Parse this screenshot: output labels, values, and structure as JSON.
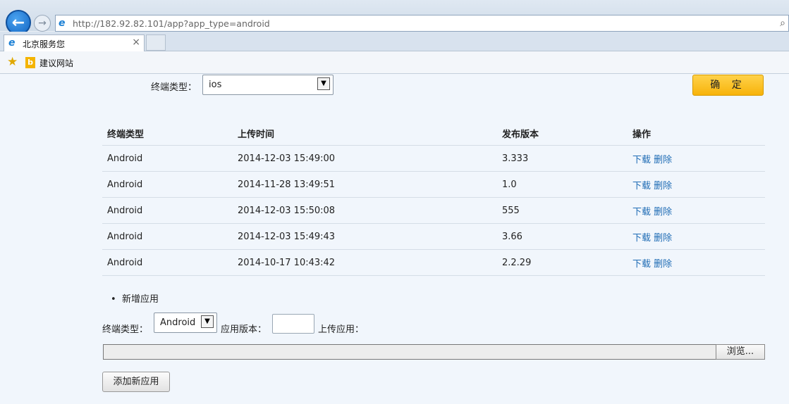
{
  "browser": {
    "url": "http://182.92.82.101/app?app_type=android",
    "tab_title": "北京服务您",
    "favorite_link": "建议网站",
    "tab_close": "×"
  },
  "filter": {
    "label": "终端类型：",
    "selected": "ios",
    "confirm_label": "确 定"
  },
  "table": {
    "headers": [
      "终端类型",
      "上传时间",
      "发布版本",
      "操作"
    ],
    "rows": [
      {
        "type": "Android",
        "time": "2014-12-03 15:49:00",
        "version": "3.333",
        "download": "下载",
        "delete": "删除"
      },
      {
        "type": "Android",
        "time": "2014-11-28 13:49:51",
        "version": "1.0",
        "download": "下载",
        "delete": "删除"
      },
      {
        "type": "Android",
        "time": "2014-12-03 15:50:08",
        "version": "555",
        "download": "下载",
        "delete": "删除"
      },
      {
        "type": "Android",
        "time": "2014-12-03 15:49:43",
        "version": "3.66",
        "download": "下载",
        "delete": "删除"
      },
      {
        "type": "Android",
        "time": "2014-10-17 10:43:42",
        "version": "2.2.29",
        "download": "下载",
        "delete": "删除"
      }
    ]
  },
  "add_section": {
    "title": "新增应用",
    "bullet": "•",
    "type_label": "终端类型：",
    "type_selected": "Android",
    "version_label": "应用版本：",
    "version_value": "",
    "upload_label": "上传应用：",
    "browse_label": "浏览...",
    "add_button": "添加新应用"
  },
  "colors": {
    "confirm_button": "#f7b30a",
    "link": "#1f6cb5",
    "page_background": "#f1f6fc"
  }
}
